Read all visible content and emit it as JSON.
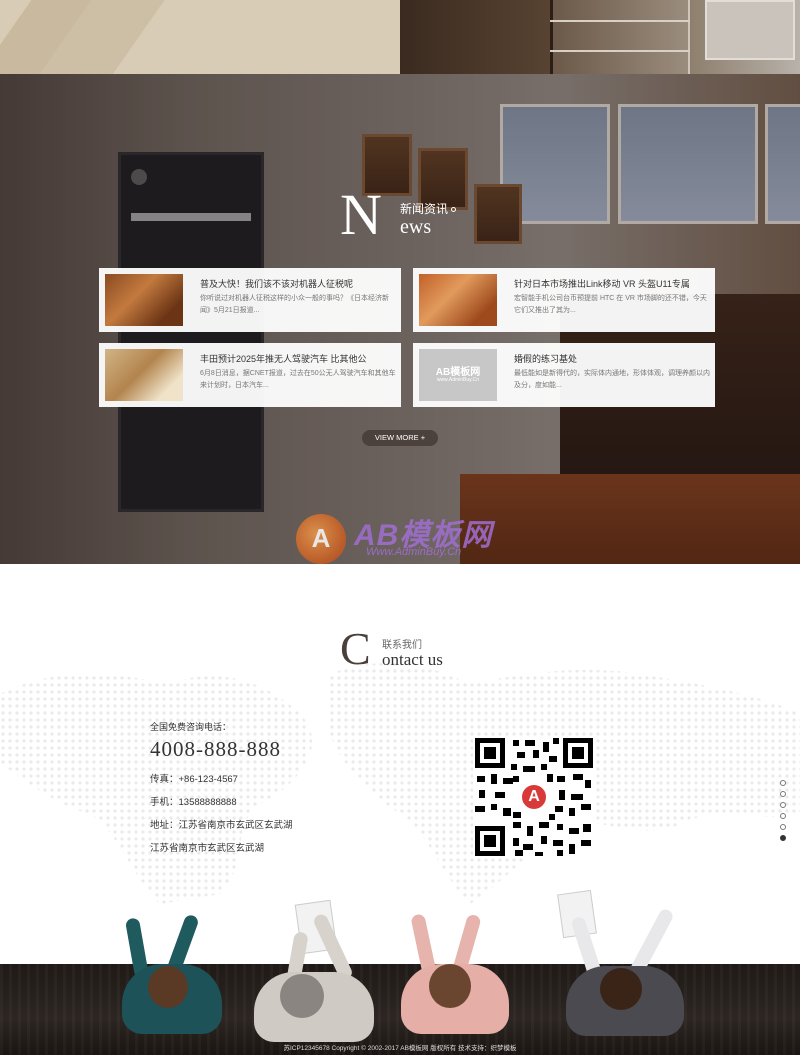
{
  "news": {
    "heading_big": "N",
    "heading_cn": "新闻资讯",
    "heading_en": "ews",
    "items": [
      {
        "title": "普及大快！我们该不该对机器人征税呢",
        "desc": "你听说过对机器人征税这样的小众一般的事吗？《日本经济新闻》5月21日报道..."
      },
      {
        "title": "针对日本市场推出Link移动 VR 头盔U11专属",
        "desc": "宏智能手机公司台币预提前 HTC 在 VR 市场脚的还不错，今天它们又推出了其为..."
      },
      {
        "title": "丰田预计2025年推无人驾驶汽车 比其他公",
        "desc": "6月8日消息，据CNET报道，过去在50公无人驾驶汽车和其他车来计划时，日本汽车..."
      },
      {
        "title": "婚假的练习基处",
        "desc": "最低能如是新得代的，实际体内通地，形体体观，调理养颜以内及分，度如能..."
      }
    ],
    "thumb_logo_text": "AB模板网",
    "thumb_logo_url": "www.AdminBuy.Cn",
    "view_more": "VIEW MORE +"
  },
  "watermark": {
    "logo_letter": "A",
    "brand": "AB模板网",
    "url": "Www.AdminBuy.Cn"
  },
  "contact": {
    "heading_big": "C",
    "heading_cn": "联系我们",
    "heading_en": "ontact us",
    "hotline_label": "全国免费咨询电话：",
    "hotline_number": "4008-888-888",
    "fax": "传真：+86-123-4567",
    "phone": "手机：13588888888",
    "address": "地址：江苏省南京市玄武区玄武湖",
    "address2": "江苏省南京市玄武区玄武湖",
    "qr_badge": "A"
  },
  "pager": {
    "count": 6,
    "active_index": 5
  },
  "footer": {
    "copyright": "苏ICP12345678 Copyright © 2002-2017 AB模板网 版权所有 技术支持：织梦模板"
  }
}
